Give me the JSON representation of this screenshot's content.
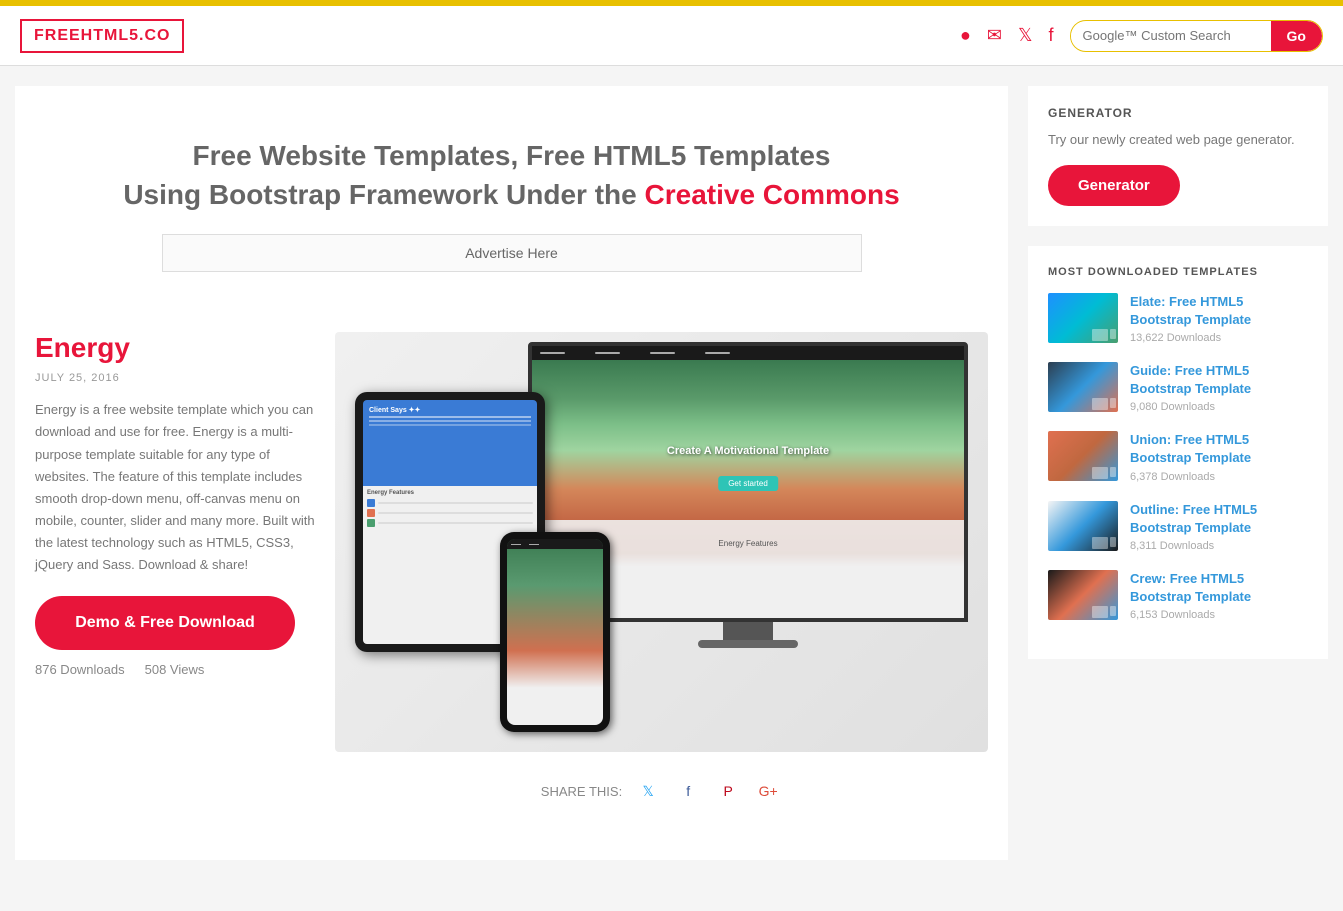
{
  "header": {
    "logo": "FREEHTML5.CO",
    "search_placeholder": "Google™ Custom Search",
    "go_button": "Go"
  },
  "hero": {
    "title_part1": "Free Website Templates, Free HTML5 Templates",
    "title_part2": "Using Bootstrap Framework Under the",
    "title_highlight": "Creative Commons",
    "advertise": "Advertise Here"
  },
  "article": {
    "title": "Energy",
    "date": "JULY 25, 2016",
    "description": "Energy is a free website template which you can download and use for free. Energy is a multi-purpose template suitable for any type of websites. The feature of this template includes smooth drop-down menu, off-canvas menu on mobile, counter, slider and many more. Built with the latest technology such as HTML5, CSS3, jQuery and Sass. Download & share!",
    "demo_button": "Demo & Free Download",
    "downloads": "876 Downloads",
    "views": "508 Views",
    "share_label": "SHARE THIS:"
  },
  "sidebar": {
    "generator_title": "GENERATOR",
    "generator_desc": "Try our newly created web page generator.",
    "generator_btn": "Generator",
    "downloads_title": "MOST DOWNLOADED TEMPLATES",
    "templates": [
      {
        "name": "Elate: Free HTML5 Bootstrap Template",
        "downloads": "13,622 Downloads",
        "thumb_class": "template-thumb-elate"
      },
      {
        "name": "Guide: Free HTML5 Bootstrap Template",
        "downloads": "9,080 Downloads",
        "thumb_class": "template-thumb-guide"
      },
      {
        "name": "Union: Free HTML5 Bootstrap Template",
        "downloads": "6,378 Downloads",
        "thumb_class": "template-thumb-union"
      },
      {
        "name": "Outline: Free HTML5 Bootstrap Template",
        "downloads": "8,311 Downloads",
        "thumb_class": "template-thumb-outline"
      },
      {
        "name": "Crew: Free HTML5 Bootstrap Template",
        "downloads": "6,153 Downloads",
        "thumb_class": "template-thumb-crew"
      }
    ]
  }
}
